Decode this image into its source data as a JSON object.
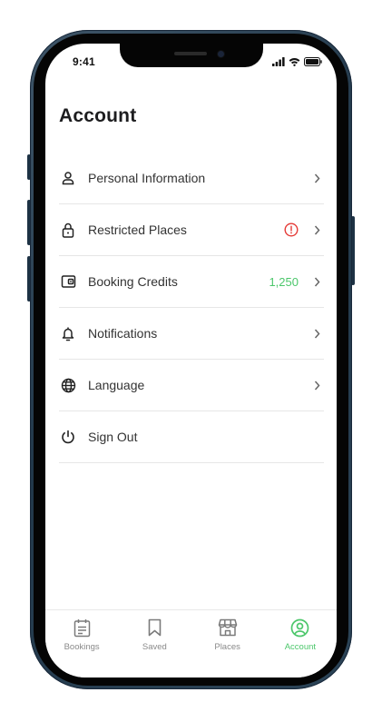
{
  "status_bar": {
    "time": "9:41"
  },
  "page": {
    "title": "Account"
  },
  "menu": {
    "items": [
      {
        "label": "Personal Information",
        "icon": "person-icon"
      },
      {
        "label": "Restricted Places",
        "icon": "lock-icon",
        "alert_icon": "alert-circle-icon"
      },
      {
        "label": "Booking Credits",
        "icon": "wallet-icon",
        "value": "1,250"
      },
      {
        "label": "Notifications",
        "icon": "bell-icon"
      },
      {
        "label": "Language",
        "icon": "globe-icon"
      },
      {
        "label": "Sign Out",
        "icon": "power-icon"
      }
    ]
  },
  "tabs": [
    {
      "label": "Bookings",
      "icon": "calendar-list-icon",
      "active": false
    },
    {
      "label": "Saved",
      "icon": "bookmark-icon",
      "active": false
    },
    {
      "label": "Places",
      "icon": "storefront-icon",
      "active": false
    },
    {
      "label": "Account",
      "icon": "user-circle-icon",
      "active": true
    }
  ],
  "colors": {
    "accent": "#4cc76b",
    "alert": "#e53935",
    "text": "#333333",
    "muted": "#8a8a8a"
  }
}
